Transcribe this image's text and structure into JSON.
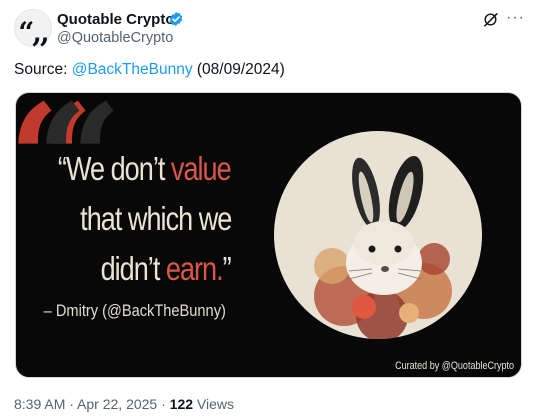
{
  "tweet": {
    "author_name": "Quotable Crypto",
    "author_handle": "@QuotableCrypto",
    "avatar_glyph": "“,,",
    "text_prefix": "Source: ",
    "mention": "@BackTheBunny",
    "text_suffix": " (08/09/2024)",
    "time": "8:39 AM",
    "separator1": " · ",
    "date": "Apr 22, 2025",
    "separator2": " · ",
    "views_count": "122",
    "views_label": " Views",
    "more_glyph": "···"
  },
  "image": {
    "quote_line1_a": "“We don’t ",
    "quote_line1_b": "value",
    "quote_line2": "that which we",
    "quote_line3_a": "didn’t ",
    "quote_line3_b": "earn.",
    "quote_line3_c": "”",
    "attribution": "– Dmitry  (@BackTheBunny)",
    "curated": "Curated by @QuotableCrypto",
    "big_quote": "“"
  },
  "colors": {
    "accent": "#1d9bf0",
    "quote_red": "#d9574a",
    "image_bg": "#080808"
  }
}
